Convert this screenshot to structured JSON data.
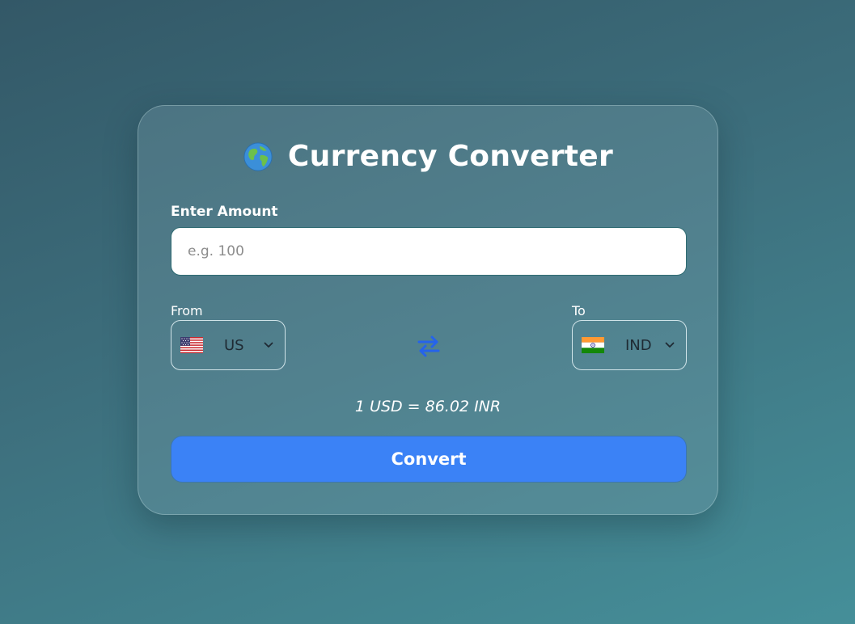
{
  "header": {
    "title": "Currency Converter",
    "icon": "globe-icon"
  },
  "amount": {
    "label": "Enter Amount",
    "placeholder": "e.g. 100",
    "value": ""
  },
  "from": {
    "label": "From",
    "flag_icon": "us-flag-icon",
    "code": "US"
  },
  "to": {
    "label": "To",
    "flag_icon": "india-flag-icon",
    "code": "IND"
  },
  "swap": {
    "icon": "swap-arrows-icon",
    "color": "#2563eb"
  },
  "rate_text": "1 USD = 86.02 INR",
  "convert": {
    "label": "Convert",
    "color": "#3b82f6"
  }
}
